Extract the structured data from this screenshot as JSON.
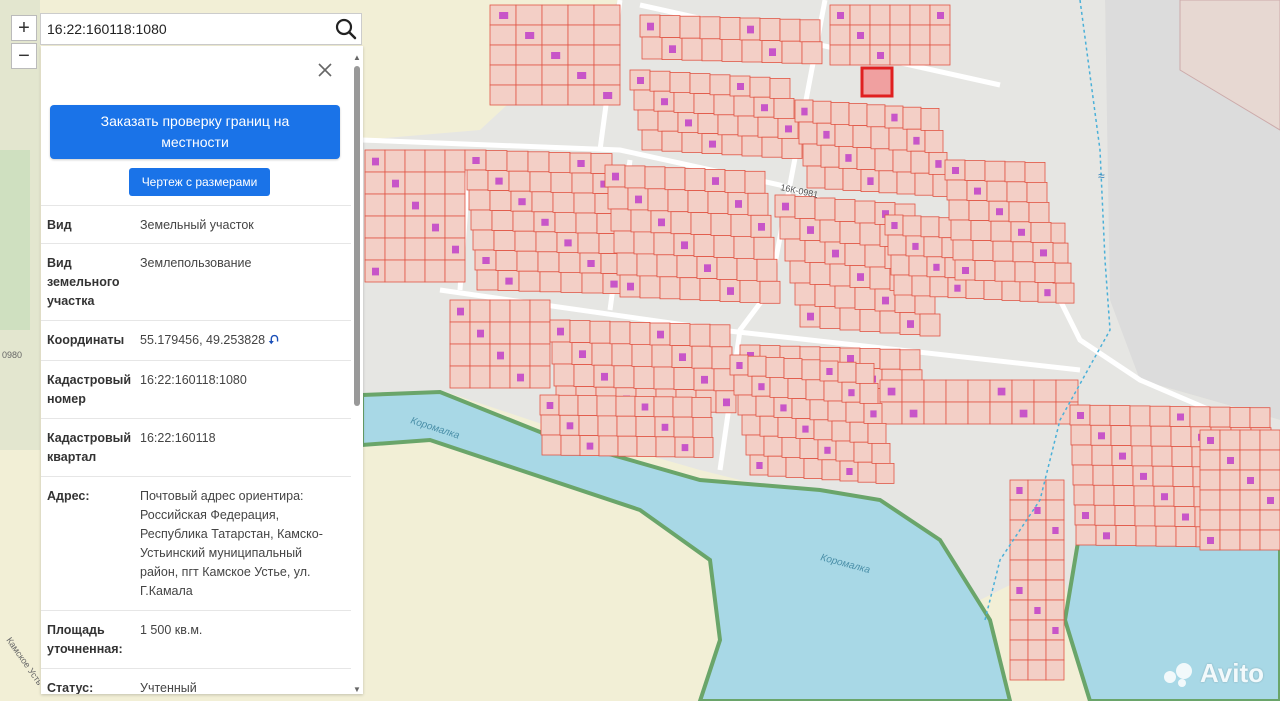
{
  "search": {
    "value": "16:22:160118:1080"
  },
  "zoom": {
    "in_label": "+",
    "out_label": "−"
  },
  "panel": {
    "order_button": "Заказать проверку границ на местности",
    "drawing_button": "Чертеж с размерами",
    "rows": [
      {
        "key": "Вид",
        "value": "Земельный участок"
      },
      {
        "key": "Вид земельного участка",
        "value": "Землепользование"
      },
      {
        "key": "Координаты",
        "value": "55.179456, 49.253828"
      },
      {
        "key": "Кадастровый номер",
        "value": "16:22:160118:1080"
      },
      {
        "key": "Кадастровый квартал",
        "value": "16:22:160118"
      },
      {
        "key": "Адрес:",
        "value": "Почтовый адрес ориентира: Российская Федерация, Республика Татарстан, Камско-Устьинский муниципальный район, пгт Камское Устье, ул. Г.Камала"
      },
      {
        "key": "Площадь уточненная:",
        "value": "1 500 кв.м."
      },
      {
        "key": "Статус:",
        "value": "Учтенный"
      }
    ]
  },
  "map_labels": {
    "road": "16К-0981",
    "river1": "Коромалка",
    "river2": "Коромалка",
    "left1": "0980",
    "left2": "Камское Усть"
  },
  "watermark": "Avito",
  "colors": {
    "parcel_fill": "#f3cfc6",
    "parcel_stroke": "#e05545",
    "water": "#a8d8e6",
    "selected": "#e02020",
    "button": "#1a73e8"
  }
}
